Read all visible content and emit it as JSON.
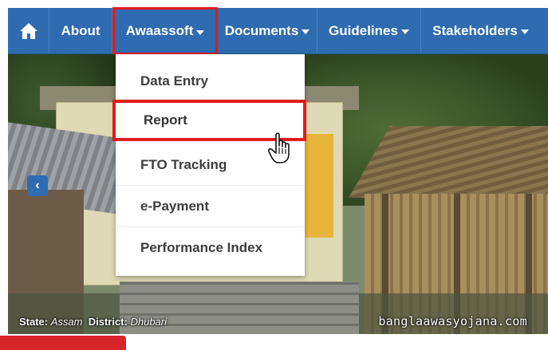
{
  "nav": {
    "items": [
      {
        "label": "About"
      },
      {
        "label": "Awaassoft"
      },
      {
        "label": "Documents"
      },
      {
        "label": "Guidelines"
      },
      {
        "label": "Stakeholders"
      }
    ]
  },
  "dropdown": {
    "items": [
      {
        "label": "Data Entry"
      },
      {
        "label": "Report"
      },
      {
        "label": "FTO Tracking"
      },
      {
        "label": "e-Payment"
      },
      {
        "label": "Performance Index"
      }
    ]
  },
  "hero": {
    "state_label": "State:",
    "state_value": "Assam",
    "district_label": "District:",
    "district_value": "Dhubari",
    "watermark": "banglaawasyojana.com",
    "prev_arrow": "‹"
  },
  "colors": {
    "nav_bg": "#2f6bb0",
    "highlight": "#e01b1b",
    "bottom_tab": "#d8232a"
  },
  "icons": {
    "home": "home-icon",
    "cursor": "hand-pointer-icon"
  }
}
